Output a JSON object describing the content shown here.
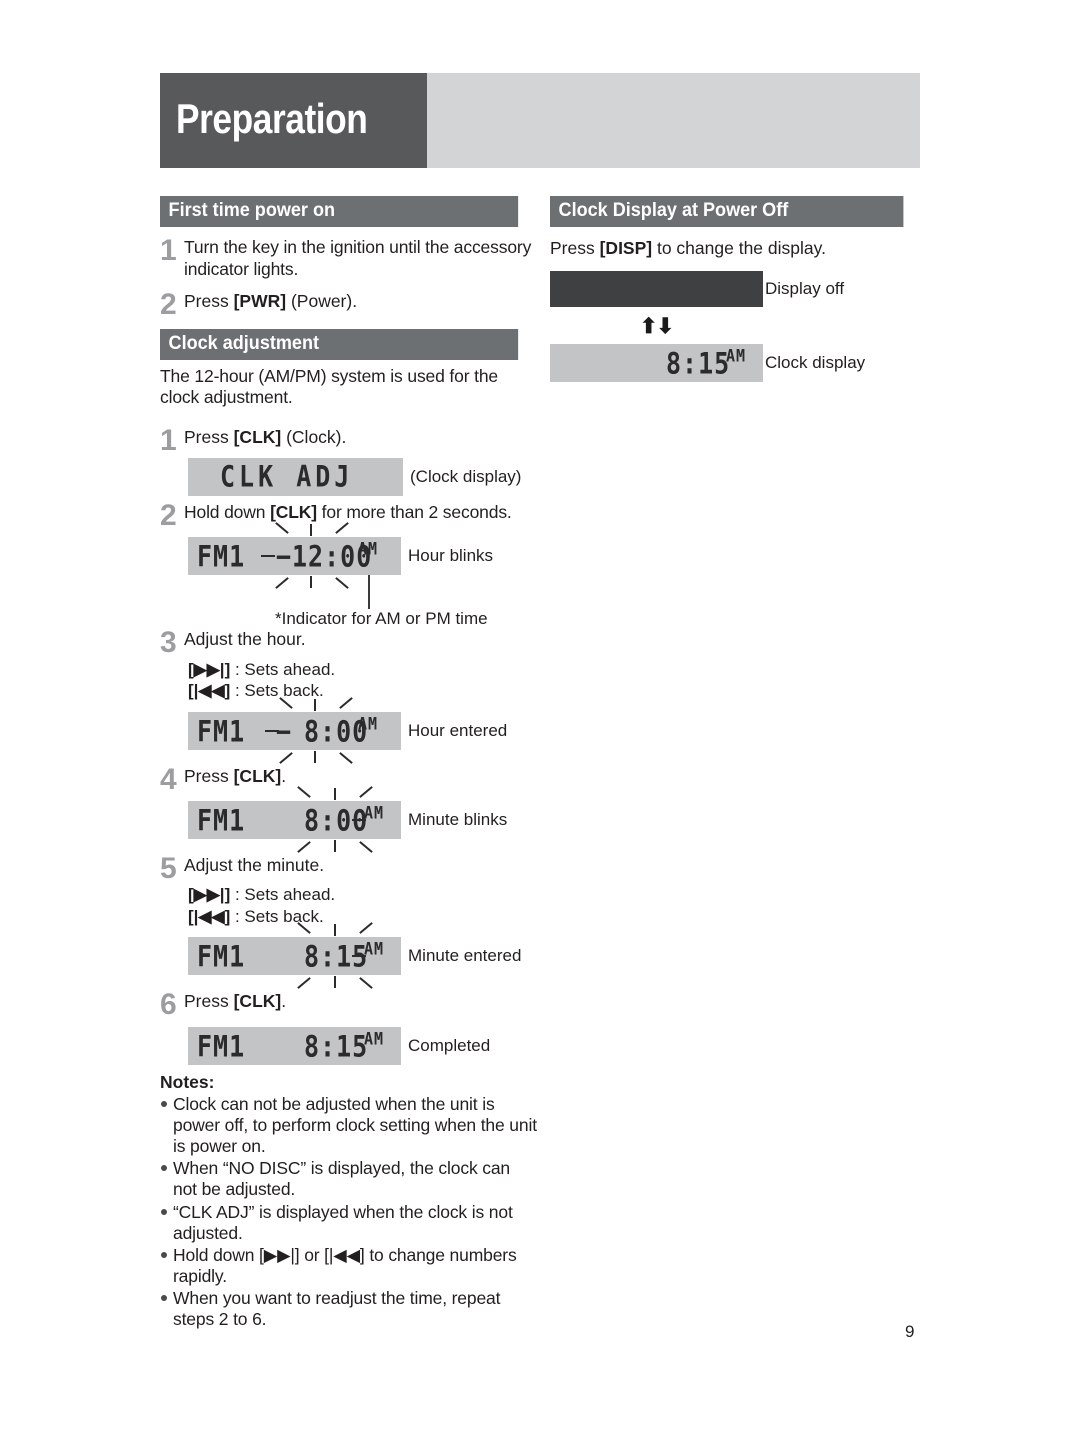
{
  "header": {
    "title": "Preparation"
  },
  "page_number": "9",
  "left_column": {
    "section1": {
      "heading": "First time power on",
      "steps": [
        {
          "n": "1",
          "text": "Turn the key in the ignition until the accessory indicator lights."
        },
        {
          "n": "2",
          "text_pre": "Press ",
          "bold": "[PWR]",
          "text_post": " (Power)."
        }
      ]
    },
    "section2": {
      "heading": "Clock adjustment",
      "intro": "The 12-hour (AM/PM) system is used for the clock adjustment.",
      "steps": [
        {
          "n": "1",
          "text_pre": "Press ",
          "bold": "[CLK]",
          "text_post": " (Clock).",
          "lcd": {
            "text": "CLK ADJ",
            "caption": "(Clock display)"
          }
        },
        {
          "n": "2",
          "text_pre": "Hold down ",
          "bold": "[CLK]",
          "text_post": " for more than 2 seconds.",
          "lcd": {
            "band": "FM1",
            "time": "12:00",
            "meridiem": "AM",
            "dash": true,
            "caption": "Hour blinks",
            "blink": "hour"
          },
          "footnote": "*Indicator for AM or PM time"
        },
        {
          "n": "3",
          "text": "Adjust the hour.",
          "keys": [
            {
              "key": "[▶▶|]",
              "desc": " : Sets ahead."
            },
            {
              "key": "[|◀◀]",
              "desc": " : Sets back."
            }
          ],
          "lcd": {
            "band": "FM1",
            "time": "8:00",
            "meridiem": "AM",
            "dash": true,
            "caption": "Hour entered",
            "blink": "hour"
          }
        },
        {
          "n": "4",
          "text_pre": "Press ",
          "bold": "[CLK]",
          "text_post": ".",
          "lcd": {
            "band": "FM1",
            "time": "8:00",
            "meridiem": "AM",
            "dash": false,
            "caption": "Minute blinks",
            "blink": "minute"
          }
        },
        {
          "n": "5",
          "text": "Adjust the minute.",
          "keys": [
            {
              "key": "[▶▶|]",
              "desc": " : Sets ahead."
            },
            {
              "key": "[|◀◀]",
              "desc": " : Sets back."
            }
          ],
          "lcd": {
            "band": "FM1",
            "time": "8:15",
            "meridiem": "AM",
            "dash": false,
            "caption": "Minute entered",
            "blink": "minute"
          }
        },
        {
          "n": "6",
          "text_pre": "Press ",
          "bold": "[CLK]",
          "text_post": ".",
          "lcd": {
            "band": "FM1",
            "time": "8:15",
            "meridiem": "AM",
            "dash": false,
            "caption": "Completed",
            "blink": "none"
          }
        }
      ]
    },
    "notes": {
      "heading": "Notes:",
      "items": [
        "Clock can not be adjusted when the unit is power off, to perform clock setting when the unit is power on.",
        "When “NO DISC” is displayed, the clock can not be adjusted.",
        "“CLK ADJ” is displayed when the clock is not adjusted.",
        "Hold down [▶▶|] or [|◀◀] to change numbers rapidly.",
        "When you want to readjust the time, repeat steps 2 to 6."
      ]
    }
  },
  "right_column": {
    "section": {
      "heading": "Clock Display at Power Off",
      "intro_pre": "Press ",
      "intro_bold": "[DISP]",
      "intro_post": " to change the display.",
      "display_off_caption": "Display off",
      "toggle_arrows": "⬆⬇",
      "clock_lcd": {
        "time": "8:15",
        "meridiem": "AM",
        "caption": "Clock display"
      }
    }
  },
  "colors": {
    "title_box": "#57595b",
    "title_bar": "#d3d4d6",
    "section_bar": "#6d7073",
    "lcd_bg": "#c3c4c6",
    "lcd_off": "#3f4042",
    "step_number": "#9b9da0",
    "text": "#231f20"
  }
}
